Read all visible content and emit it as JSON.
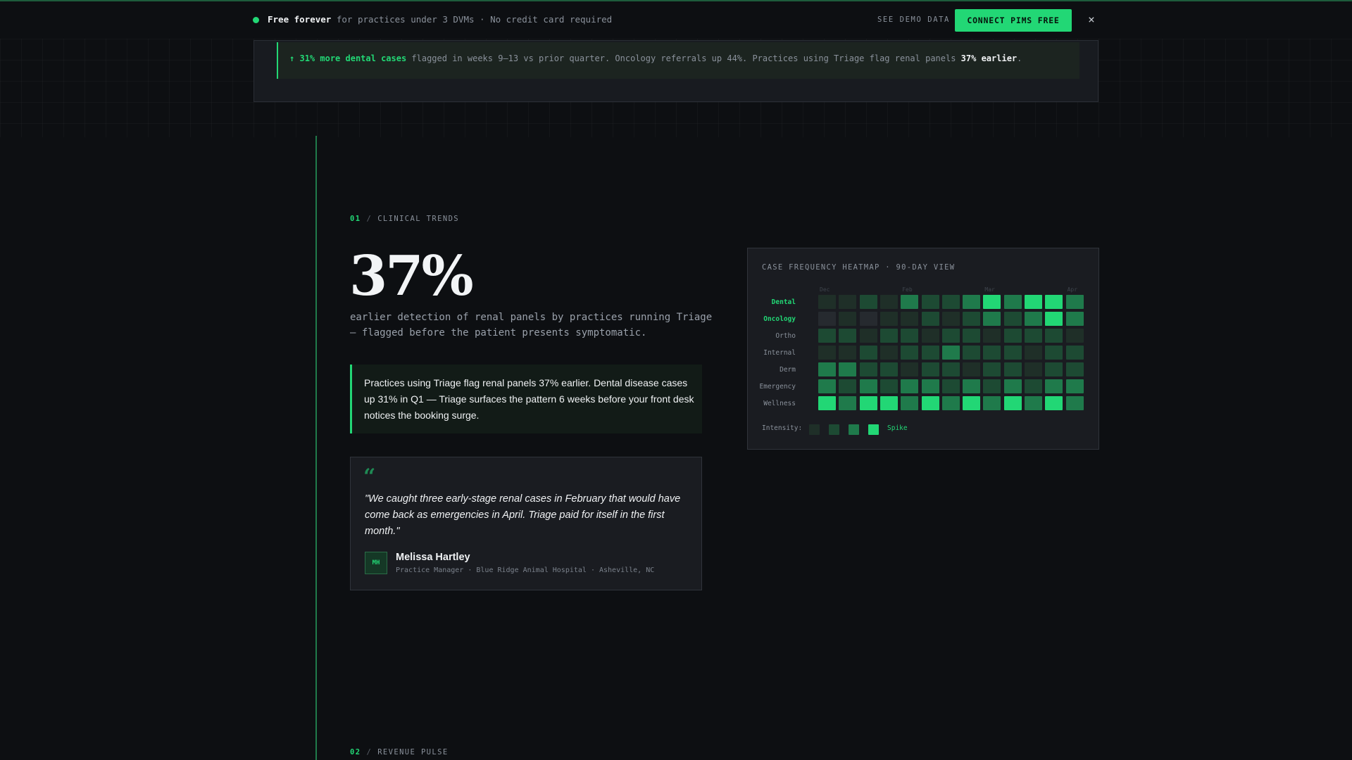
{
  "topbar": {
    "strong": "Free forever",
    "text": " for practices under 3 DVMs · No credit card required",
    "demo_link": "SEE DEMO DATA",
    "cta": "CONNECT PIMS FREE",
    "close": "×"
  },
  "insight": {
    "arrow": "↑",
    "highlight": "31% more dental cases",
    "middle": " flagged in weeks 9–13 vs prior quarter. Oncology referrals up 44%. Practices using Triage flag renal panels ",
    "emphasis": "37% earlier",
    "end": "."
  },
  "section1": {
    "num": "01",
    "slash": "/",
    "label": "CLINICAL TRENDS",
    "stat": "37%",
    "lead": "earlier detection of renal panels by practices running Triage — flagged before the patient presents symptomatic.",
    "callout": "Practices using Triage flag renal panels 37% earlier. Dental disease cases up 31% in Q1 — Triage surfaces the pattern 6 weeks before your front desk notices the booking surge.",
    "quote": {
      "mark": "“",
      "text": "\"We caught three early-stage renal cases in February that would have come back as emergencies in April. Triage paid for itself in the first month.\"",
      "initials": "MH",
      "name": "Melissa Hartley",
      "role": "Practice Manager · Blue Ridge Animal Hospital · Asheville, NC"
    }
  },
  "heatmap": {
    "title": "CASE FREQUENCY HEATMAP · 90-DAY VIEW",
    "months": [
      "Dec",
      "Feb",
      "Mar",
      "Apr"
    ],
    "rows": [
      {
        "label": "Dental",
        "highlight": true,
        "levels": [
          0,
          0,
          1,
          0,
          2,
          1,
          1,
          2,
          3,
          2,
          3,
          3,
          2
        ]
      },
      {
        "label": "Oncology",
        "highlight": true,
        "levels": [
          "x",
          0,
          "x",
          0,
          0,
          1,
          0,
          1,
          2,
          1,
          2,
          3,
          2
        ]
      },
      {
        "label": "Ortho",
        "highlight": false,
        "levels": [
          1,
          1,
          0,
          1,
          1,
          0,
          1,
          1,
          0,
          1,
          1,
          1,
          0
        ]
      },
      {
        "label": "Internal",
        "highlight": false,
        "levels": [
          0,
          0,
          1,
          0,
          1,
          1,
          2,
          1,
          1,
          1,
          0,
          1,
          1
        ]
      },
      {
        "label": "Derm",
        "highlight": false,
        "levels": [
          2,
          2,
          1,
          1,
          0,
          1,
          1,
          0,
          1,
          1,
          0,
          1,
          1
        ]
      },
      {
        "label": "Emergency",
        "highlight": false,
        "levels": [
          2,
          1,
          2,
          1,
          2,
          2,
          1,
          2,
          1,
          2,
          1,
          2,
          2
        ]
      },
      {
        "label": "Wellness",
        "highlight": false,
        "levels": [
          3,
          2,
          3,
          3,
          2,
          3,
          2,
          3,
          2,
          3,
          2,
          3,
          2
        ]
      }
    ],
    "legend_label": "Intensity:",
    "legend_levels": [
      0,
      1,
      2,
      3
    ],
    "legend_spike": "Spike"
  },
  "section2": {
    "num": "02",
    "slash": "/",
    "label": "REVENUE PULSE"
  },
  "colors": {
    "accent": "#22d775",
    "background": "#0d0f12",
    "card": "#1a1c21"
  }
}
